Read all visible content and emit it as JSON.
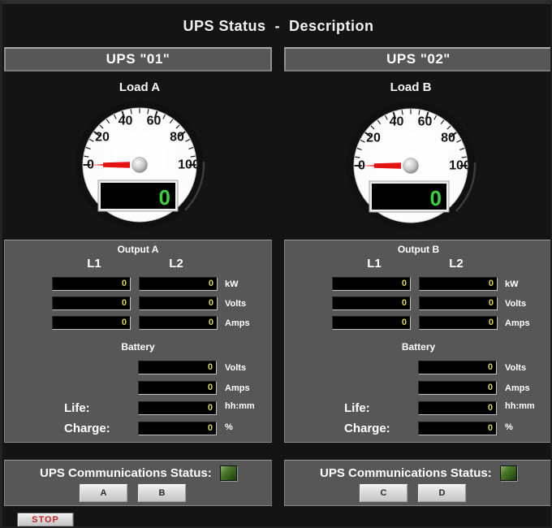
{
  "title": "UPS Status  -  Description",
  "stop_button": "STOP",
  "colors": {
    "panel_gray": "#575757",
    "digit_yellow": "#d9d955",
    "gauge_green": "#3bd23b",
    "needle_red": "#e51212",
    "led_green": "#2f6b1a",
    "stop_red": "#c52525"
  },
  "columns": [
    {
      "header": "UPS \"01\"",
      "gauge": {
        "title": "Load A",
        "value": "0",
        "scale": [
          "0",
          "20",
          "40",
          "60",
          "80",
          "100"
        ],
        "min": 0,
        "max": 100
      },
      "output": {
        "heading": "Output A",
        "phase_headers": [
          "L1",
          "L2"
        ],
        "rows": [
          {
            "unit": "kW",
            "l1": "0",
            "l2": "0"
          },
          {
            "unit": "Volts",
            "l1": "0",
            "l2": "0"
          },
          {
            "unit": "Amps",
            "l1": "0",
            "l2": "0"
          }
        ]
      },
      "battery": {
        "heading": "Battery",
        "rows": [
          {
            "label": "",
            "value": "0",
            "unit": "Volts"
          },
          {
            "label": "",
            "value": "0",
            "unit": "Amps"
          },
          {
            "label": "Life:",
            "value": "0",
            "unit": "hh:mm"
          },
          {
            "label": "Charge:",
            "value": "0",
            "unit": "%"
          }
        ]
      },
      "comms": {
        "label": "UPS Communications Status:",
        "buttons": [
          "A",
          "B"
        ]
      }
    },
    {
      "header": "UPS \"02\"",
      "gauge": {
        "title": "Load B",
        "value": "0",
        "scale": [
          "0",
          "20",
          "40",
          "60",
          "80",
          "100"
        ],
        "min": 0,
        "max": 100
      },
      "output": {
        "heading": "Output B",
        "phase_headers": [
          "L1",
          "L2"
        ],
        "rows": [
          {
            "unit": "kW",
            "l1": "0",
            "l2": "0"
          },
          {
            "unit": "Volts",
            "l1": "0",
            "l2": "0"
          },
          {
            "unit": "Amps",
            "l1": "0",
            "l2": "0"
          }
        ]
      },
      "battery": {
        "heading": "Battery",
        "rows": [
          {
            "label": "",
            "value": "0",
            "unit": "Volts"
          },
          {
            "label": "",
            "value": "0",
            "unit": "Amps"
          },
          {
            "label": "Life:",
            "value": "0",
            "unit": "hh:mm"
          },
          {
            "label": "Charge:",
            "value": "0",
            "unit": "%"
          }
        ]
      },
      "comms": {
        "label": "UPS Communications Status:",
        "buttons": [
          "C",
          "D"
        ]
      }
    }
  ]
}
